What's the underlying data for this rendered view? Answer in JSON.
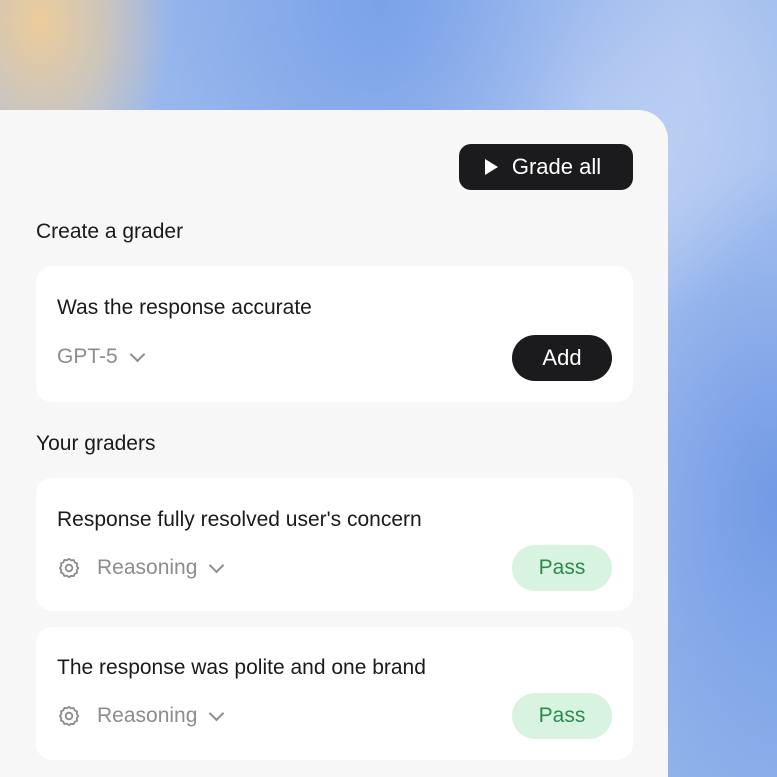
{
  "toolbar": {
    "grade_all_label": "Grade all"
  },
  "create_grader": {
    "section_title": "Create a grader",
    "prompt_text": "Was the response accurate",
    "model_label": "GPT-5",
    "add_label": "Add"
  },
  "your_graders": {
    "section_title": "Your graders",
    "items": [
      {
        "title": "Response fully resolved user's concern",
        "type_label": "Reasoning",
        "status": "Pass"
      },
      {
        "title": "The response was polite and one brand",
        "type_label": "Reasoning",
        "status": "Pass"
      }
    ]
  },
  "icons": {
    "play": "play-icon",
    "chevron": "chevron-down-icon",
    "gear": "gear-icon"
  },
  "colors": {
    "button_dark": "#1b1b1d",
    "panel_bg": "#f7f7f8",
    "card_bg": "#ffffff",
    "pass_bg": "#d9f3e1",
    "pass_text": "#2c8a4d",
    "muted_text": "#8c8c8c"
  }
}
